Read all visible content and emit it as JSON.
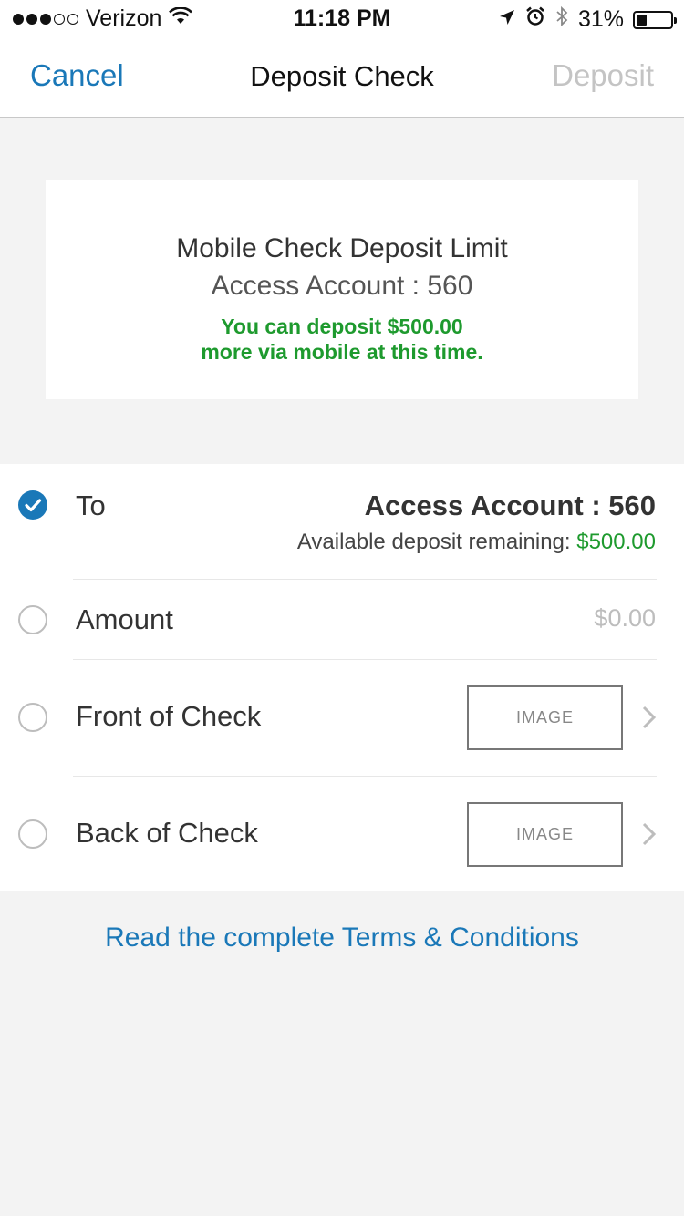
{
  "status_bar": {
    "carrier": "Verizon",
    "time": "11:18 PM",
    "battery_percent": "31%",
    "battery_level": 0.31,
    "icons": [
      "signal-dots",
      "wifi-icon",
      "location-arrow-icon",
      "alarm-icon",
      "bluetooth-icon",
      "battery-icon"
    ]
  },
  "nav": {
    "cancel_label": "Cancel",
    "title": "Deposit Check",
    "deposit_label": "Deposit"
  },
  "limit_card": {
    "title": "Mobile Check Deposit Limit",
    "account": "Access Account : 560",
    "message_line1": "You can deposit $500.00",
    "message_line2": "more via mobile at this time."
  },
  "form": {
    "to": {
      "label": "To",
      "value": "Access Account : 560",
      "available_label": "Available deposit remaining:",
      "available_amount": "$500.00",
      "checked": true
    },
    "amount": {
      "label": "Amount",
      "placeholder": "$0.00"
    },
    "front": {
      "label": "Front of Check",
      "image_label": "IMAGE"
    },
    "back": {
      "label": "Back of Check",
      "image_label": "IMAGE"
    }
  },
  "terms_link": "Read the complete Terms & Conditions",
  "colors": {
    "accent_blue": "#1a78b8",
    "success_green": "#1e9a2e",
    "disabled_gray": "#c4c4c4",
    "background": "#f3f3f3"
  }
}
